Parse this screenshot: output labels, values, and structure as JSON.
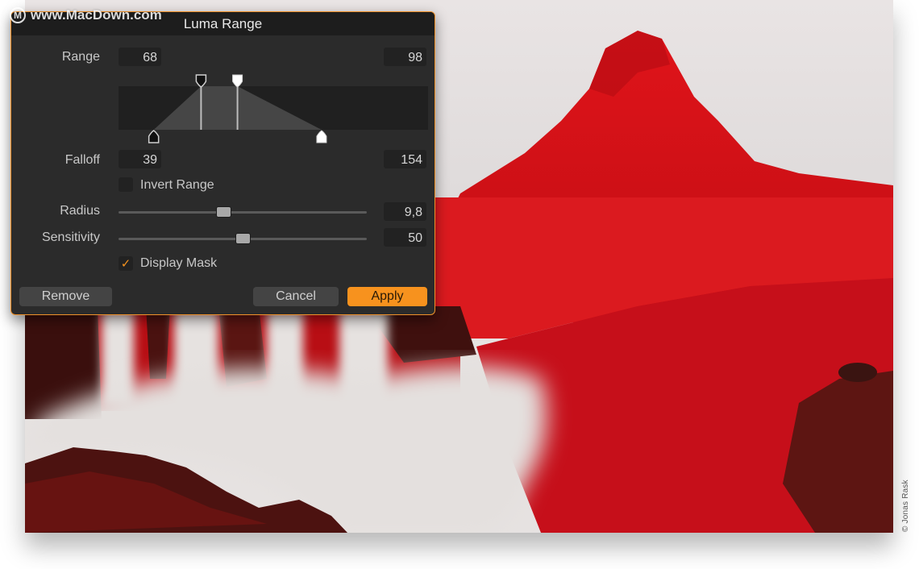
{
  "watermark": {
    "logo_glyph": "M",
    "text": "www.MacDown.com"
  },
  "dialog": {
    "title": "Luma Range",
    "accent_color": "#f7921e",
    "range": {
      "label": "Range",
      "low": "68",
      "high": "98"
    },
    "falloff": {
      "label": "Falloff",
      "low": "39",
      "high": "154"
    },
    "invert_range": {
      "label": "Invert Range",
      "checked": false
    },
    "radius": {
      "label": "Radius",
      "value": "9,8",
      "slider_fraction": 0.42
    },
    "sensitivity": {
      "label": "Sensitivity",
      "value": "50",
      "slider_fraction": 0.5
    },
    "display_mask": {
      "label": "Display Mask",
      "checked": true,
      "check_glyph": "✓"
    },
    "buttons": {
      "remove": "Remove",
      "cancel": "Cancel",
      "apply": "Apply"
    },
    "luma_scale_max": 255
  },
  "photo": {
    "description": "Kirkjufell mountain with waterfall, luma mask shown in red",
    "mask_color": "#d40d14",
    "credit": "© Jonas Rask"
  }
}
